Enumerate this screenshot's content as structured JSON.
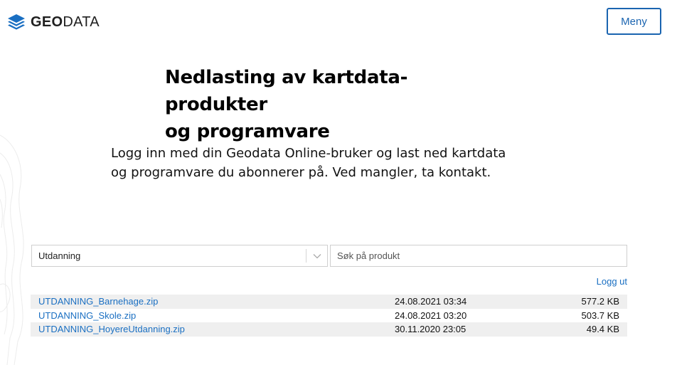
{
  "header": {
    "logo": {
      "bold": "GEO",
      "light": "DATA",
      "icon": "layers-stack-icon",
      "color": "#1a6fc2"
    },
    "menu_label": "Meny"
  },
  "hero": {
    "title_line1": "Nedlasting av kartdata-produkter",
    "title_line2": "og programvare",
    "intro": "Logg inn med din Geodata Online-bruker og last ned kartdata og programvare du abonnerer på. Ved mangler, ta kontakt."
  },
  "filters": {
    "category_selected": "Utdanning",
    "search_placeholder": "Søk på produkt",
    "search_value": ""
  },
  "logout_label": "Logg ut",
  "files": [
    {
      "name": "UTDANNING_Barnehage.zip",
      "date": "24.08.2021 03:34",
      "size": "577.2 KB"
    },
    {
      "name": "UTDANNING_Skole.zip",
      "date": "24.08.2021 03:20",
      "size": "503.7 KB"
    },
    {
      "name": "UTDANNING_HoyereUtdanning.zip",
      "date": "30.11.2020 23:05",
      "size": "49.4 KB"
    }
  ],
  "colors": {
    "accent": "#1a6fc2",
    "button_border": "#1a64b0",
    "row_alt": "#efefef"
  }
}
